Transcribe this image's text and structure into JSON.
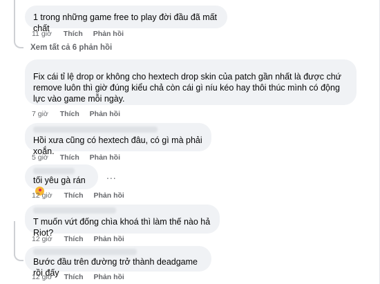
{
  "comments": [
    {
      "text": "1 trong những game free to play đời đầu đã mất chất",
      "time": "11 giờ",
      "like": "Thích",
      "reply": "Phản hồi"
    },
    {
      "text": "Fix cái tỉ lệ drop or không cho hextech drop skin của patch gần nhất là được chứ remove luôn thì giờ đúng kiểu chả còn cái gì níu kéo hay thôi thúc mình có động lực vào game mỗi ngày.",
      "time": "7 giờ",
      "like": "Thích",
      "reply": "Phản hồi"
    },
    {
      "text": "Hồi xưa cũng có hextech đâu, có gì mà phải xoắn.",
      "time": "5 giờ",
      "like": "Thích",
      "reply": "Phản hồi"
    },
    {
      "text": "tối yêu gà rán",
      "emoji": "smiling-face-with-hearts",
      "time": "12 giờ",
      "like": "Thích",
      "reply": "Phản hồi",
      "more": "..."
    },
    {
      "text": "T muốn vứt đống chìa khoá thì làm thế nào hả Riot?",
      "time": "12 giờ",
      "like": "Thích",
      "reply": "Phản hồi"
    },
    {
      "text": "Bước đầu trên đường trở thành deadgame rồi đấy",
      "time": "12 giờ",
      "like": "Thích",
      "reply": "Phản hồi"
    }
  ],
  "view_replies": "Xem tất cả 6 phản hồi",
  "colors": {
    "bubble": "#f0f2f5",
    "meta": "#65676b",
    "text": "#050505"
  }
}
